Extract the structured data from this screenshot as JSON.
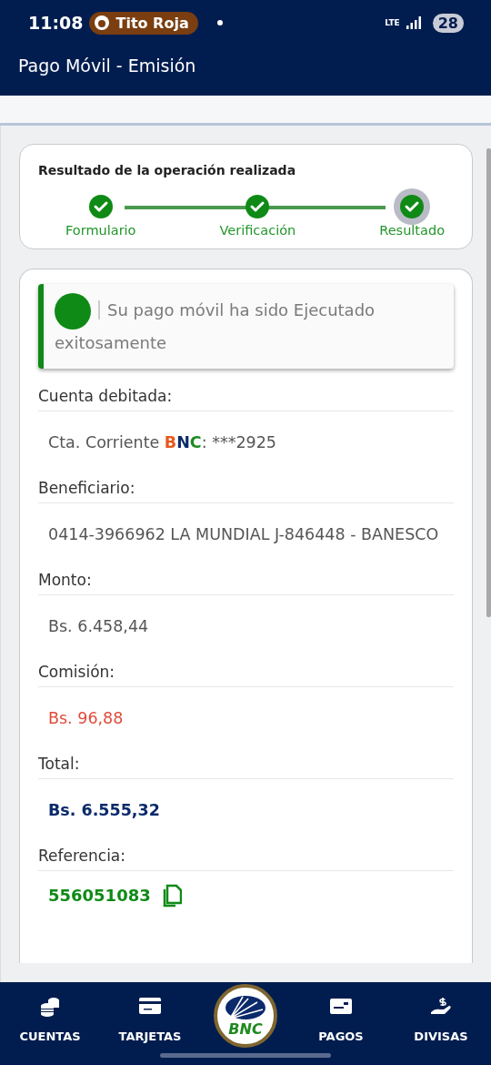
{
  "status_bar": {
    "time": "11:08",
    "notification": "Tito Roja",
    "battery": "28",
    "network": "LTE"
  },
  "app_bar": {
    "title": "Pago Móvil - Emisión"
  },
  "progress": {
    "title": "Resultado de la operación realizada",
    "steps": [
      {
        "label": "Formulario",
        "done": true,
        "selected": false
      },
      {
        "label": "Verificación",
        "done": true,
        "selected": false
      },
      {
        "label": "Resultado",
        "done": true,
        "selected": true
      }
    ]
  },
  "alert": {
    "message": "Su pago móvil ha sido Ejecutado exitosamente"
  },
  "fields": [
    {
      "kind": "account",
      "label": "Cuenta debitada:",
      "value": "Cta. Corriente ",
      "brand": [
        {
          "text": "B",
          "color": "#e8581c"
        },
        {
          "text": "N",
          "color": "#0b2a6b"
        },
        {
          "text": "C",
          "color": "#1e8a1e"
        }
      ],
      "suffix": ": ***2925"
    },
    {
      "kind": "plain",
      "label": "Beneficiario:",
      "value": "0414-3966962 LA MUNDIAL J-846448 - BANESCO"
    },
    {
      "kind": "plain",
      "label": "Monto:",
      "value": "Bs. 6.458,44"
    },
    {
      "kind": "fee",
      "label": "Comisión:",
      "value": "Bs. 96,88"
    },
    {
      "kind": "total",
      "label": "Total:",
      "value": "Bs. 6.555,32"
    },
    {
      "kind": "reference",
      "label": "Referencia:",
      "value": "556051083"
    }
  ],
  "nav": [
    {
      "label": "CUENTAS",
      "kind": "tab"
    },
    {
      "label": "TARJETAS",
      "kind": "tab"
    },
    {
      "label": "BNC",
      "kind": "logo"
    },
    {
      "label": "PAGOS",
      "kind": "tab"
    },
    {
      "label": "DIVISAS",
      "kind": "tab"
    }
  ]
}
